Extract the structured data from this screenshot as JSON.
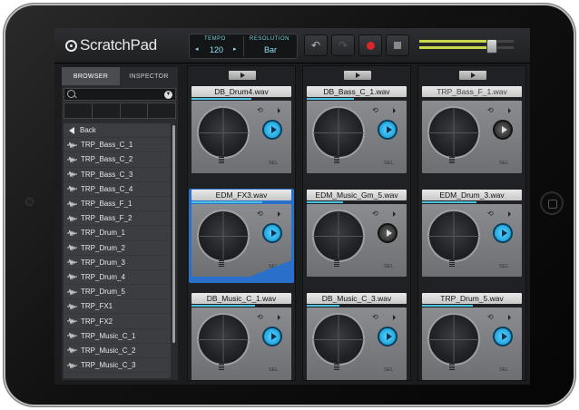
{
  "app": {
    "logo": "ScratchPad"
  },
  "transport": {
    "tempo_label": "TEMPO",
    "tempo_value": "120",
    "resolution_label": "RESOLUTION",
    "resolution_value": "Bar"
  },
  "sidebar": {
    "tabs": [
      {
        "label": "BROWSER"
      },
      {
        "label": "INSPECTOR"
      }
    ],
    "items": [
      {
        "label": "Back"
      },
      {
        "label": "TRP_Bass_C_1"
      },
      {
        "label": "TRP_Bass_C_2"
      },
      {
        "label": "TRP_Bass_C_3"
      },
      {
        "label": "TRP_Bass_C_4"
      },
      {
        "label": "TRP_Bass_F_1"
      },
      {
        "label": "TRP_Bass_F_2"
      },
      {
        "label": "TRP_Drum_1"
      },
      {
        "label": "TRP_Drum_2"
      },
      {
        "label": "TRP_Drum_3"
      },
      {
        "label": "TRP_Drum_4"
      },
      {
        "label": "TRP_Drum_5"
      },
      {
        "label": "TRP_FX1"
      },
      {
        "label": "TRP_FX2"
      },
      {
        "label": "TRP_Music_C_1"
      },
      {
        "label": "TRP_Music_C_2"
      },
      {
        "label": "TRP_Music_C_3"
      }
    ]
  },
  "pads": [
    {
      "name": "DB_Drum4.wav",
      "playing": true,
      "sel_label": "SEL"
    },
    {
      "name": "DB_Bass_C_1.wav",
      "playing": true,
      "sel_label": "SEL"
    },
    {
      "name": "TRP_Bass_F_1.wav",
      "playing": false,
      "sel_label": "SEL"
    },
    {
      "name": "EDM_FX3.wav",
      "playing": true,
      "sel_label": "SEL"
    },
    {
      "name": "EDM_Music_Gm_5.wav",
      "playing": false,
      "sel_label": "SEL"
    },
    {
      "name": "EDM_Drum_3.wav",
      "playing": true,
      "sel_label": "SEL"
    },
    {
      "name": "DB_Music_C_1.wav",
      "playing": true,
      "sel_label": "SEL"
    },
    {
      "name": "DB_Music_C_3.wav",
      "playing": true,
      "sel_label": "SEL"
    },
    {
      "name": "TRP_Drum_5.wav",
      "playing": true,
      "sel_label": "SEL"
    }
  ],
  "colors": {
    "accent": "#4bc3e0",
    "selected": "#2a6fc9",
    "record": "#d9262b"
  }
}
